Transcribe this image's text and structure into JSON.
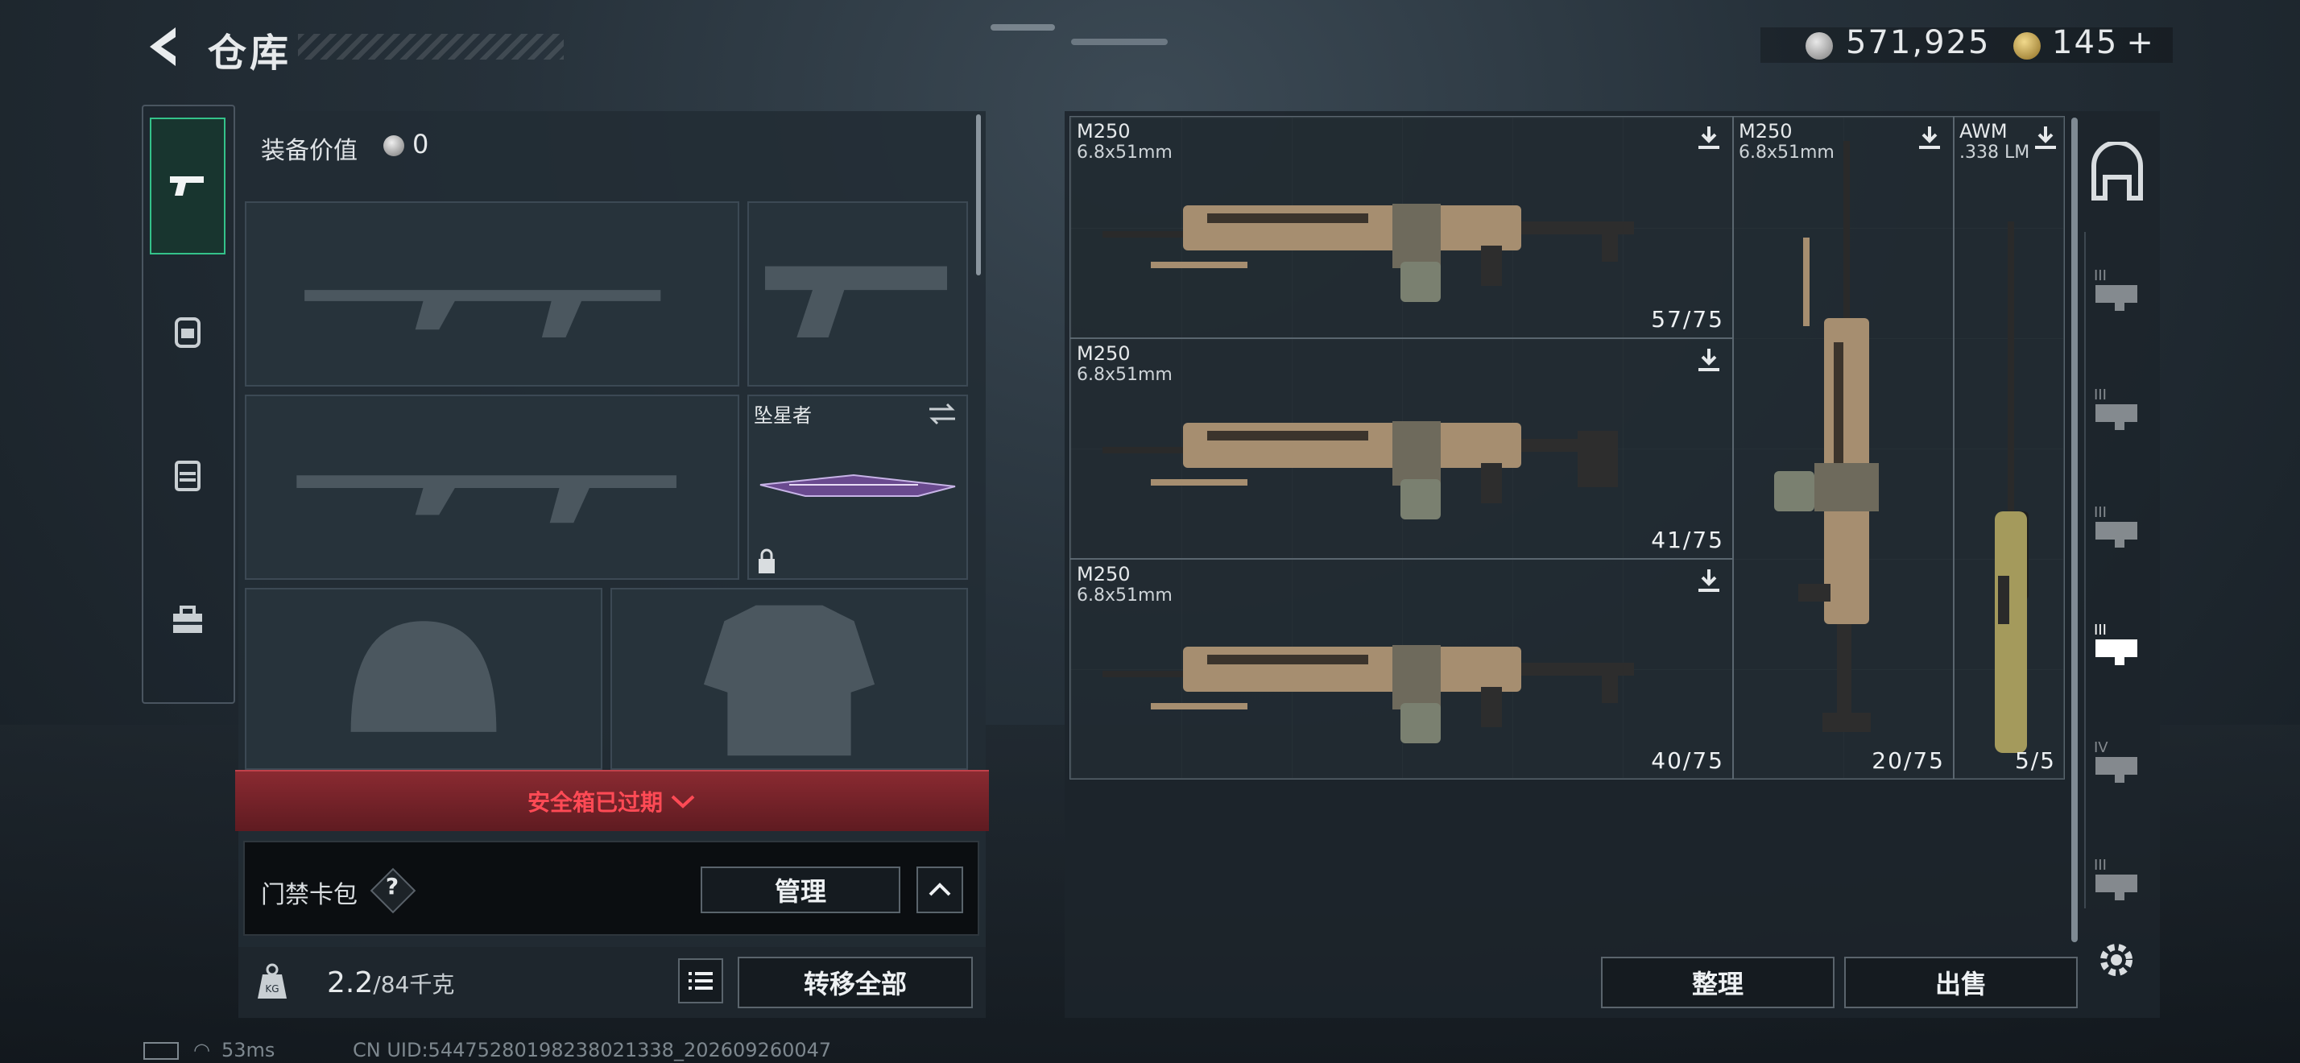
{
  "header": {
    "title": "仓库"
  },
  "currency": {
    "silver": "571,925",
    "gold": "145",
    "gold_plus": "+"
  },
  "loadout": {
    "value_label": "装备价值",
    "value": "0",
    "melee_label": "坠星者",
    "safebox_expired": "安全箱已过期",
    "keycard_label": "门禁卡包",
    "help": "?",
    "manage_button": "管理",
    "weight_current": "2.2",
    "weight_max": "/84千克",
    "transfer_all_button": "转移全部"
  },
  "storage": {
    "weapons": [
      {
        "name": "M250",
        "caliber": "6.8x51mm",
        "count": "57/75"
      },
      {
        "name": "M250",
        "caliber": "6.8x51mm",
        "count": "41/75"
      },
      {
        "name": "M250",
        "caliber": "6.8x51mm",
        "count": "40/75"
      },
      {
        "name": "M250",
        "caliber": "6.8x51mm",
        "count": "20/75"
      },
      {
        "name": "AWM",
        "caliber": ".338 LM",
        "count": "5/5"
      }
    ],
    "sort_button": "整理",
    "sell_button": "出售"
  },
  "status": {
    "ping": "53ms",
    "uid": "CN UID:544752801982380213​38_202609260047"
  },
  "colors": {
    "accent": "#34c28a",
    "alert": "#ff4a55"
  }
}
